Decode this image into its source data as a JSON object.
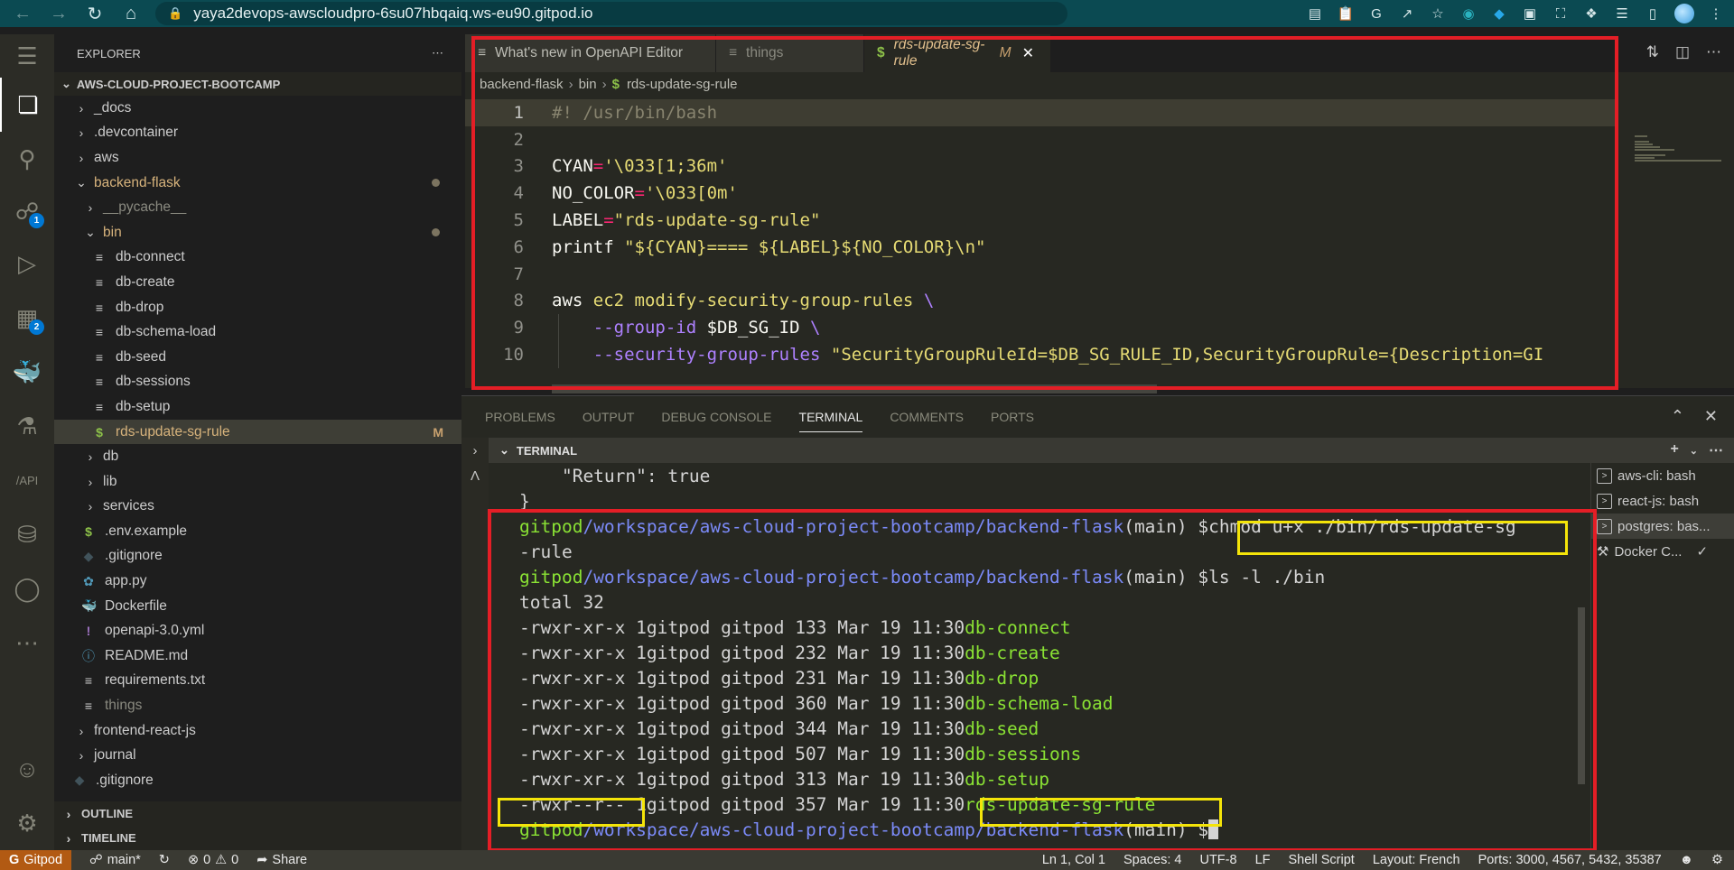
{
  "browser": {
    "url": "yaya2devops-awscloudpro-6su07hbqaiq.ws-eu90.gitpod.io"
  },
  "activity_bar": {
    "items": [
      {
        "name": "explorer",
        "icon": "files-icon"
      },
      {
        "name": "search",
        "icon": "search-icon"
      },
      {
        "name": "source-control",
        "icon": "source-control-icon",
        "badge": "1"
      },
      {
        "name": "run-debug",
        "icon": "run-debug-icon"
      },
      {
        "name": "extensions",
        "icon": "extensions-icon",
        "badge": "2"
      },
      {
        "name": "docker",
        "icon": "docker-icon"
      },
      {
        "name": "testing",
        "icon": "flask-icon"
      },
      {
        "name": "openapi",
        "icon": "api-icon"
      },
      {
        "name": "database",
        "icon": "database-icon"
      },
      {
        "name": "github",
        "icon": "github-icon"
      },
      {
        "name": "more",
        "icon": "ellipsis-icon"
      }
    ],
    "account_icon": "account-icon",
    "settings_icon": "gear-icon"
  },
  "explorer": {
    "title": "EXPLORER",
    "root": "AWS-CLOUD-PROJECT-BOOTCAMP",
    "items": [
      {
        "label": "_docs",
        "type": "folder"
      },
      {
        "label": ".devcontainer",
        "type": "folder"
      },
      {
        "label": "aws",
        "type": "folder"
      },
      {
        "label": "backend-flask",
        "type": "folder-open",
        "modified": true
      },
      {
        "label": "__pycache__",
        "type": "folder"
      },
      {
        "label": "bin",
        "type": "folder-open",
        "modified": true
      },
      {
        "label": "db-connect",
        "type": "file"
      },
      {
        "label": "db-create",
        "type": "file"
      },
      {
        "label": "db-drop",
        "type": "file"
      },
      {
        "label": "db-schema-load",
        "type": "file"
      },
      {
        "label": "db-seed",
        "type": "file"
      },
      {
        "label": "db-sessions",
        "type": "file"
      },
      {
        "label": "db-setup",
        "type": "file"
      },
      {
        "label": "rds-update-sg-rule",
        "type": "shell",
        "flag": "M"
      },
      {
        "label": "db",
        "type": "folder"
      },
      {
        "label": "lib",
        "type": "folder"
      },
      {
        "label": "services",
        "type": "folder"
      },
      {
        "label": ".env.example",
        "type": "shell"
      },
      {
        "label": ".gitignore",
        "type": "git"
      },
      {
        "label": "app.py",
        "type": "python"
      },
      {
        "label": "Dockerfile",
        "type": "docker"
      },
      {
        "label": "openapi-3.0.yml",
        "type": "yaml"
      },
      {
        "label": "README.md",
        "type": "info"
      },
      {
        "label": "requirements.txt",
        "type": "file"
      },
      {
        "label": "things",
        "type": "file"
      },
      {
        "label": "frontend-react-js",
        "type": "folder"
      },
      {
        "label": "journal",
        "type": "folder"
      },
      {
        "label": ".gitignore",
        "type": "git"
      }
    ],
    "outline": "OUTLINE",
    "timeline": "TIMELINE"
  },
  "editor": {
    "tabs": [
      {
        "label": "What's new in OpenAPI Editor",
        "active": false
      },
      {
        "label": "things",
        "active": false
      },
      {
        "label": "rds-update-sg-rule",
        "active": true,
        "flag": "M"
      }
    ],
    "breadcrumb": [
      "backend-flask",
      "bin",
      "rds-update-sg-rule"
    ],
    "lines": [
      {
        "n": "1",
        "text": "#! /usr/bin/bash"
      },
      {
        "n": "2",
        "text": ""
      },
      {
        "n": "3",
        "text": "CYAN='\\033[1;36m'"
      },
      {
        "n": "4",
        "text": "NO_COLOR='\\033[0m'"
      },
      {
        "n": "5",
        "text": "LABEL=\"rds-update-sg-rule\""
      },
      {
        "n": "6",
        "text": "printf \"${CYAN}==== ${LABEL}${NO_COLOR}\\n\""
      },
      {
        "n": "7",
        "text": ""
      },
      {
        "n": "8",
        "text": "aws ec2 modify-security-group-rules \\"
      },
      {
        "n": "9",
        "text": "    --group-id $DB_SG_ID \\"
      },
      {
        "n": "10",
        "text": "    --security-group-rules \"SecurityGroupRuleId=$DB_SG_RULE_ID,SecurityGroupRule={Description=GI"
      }
    ]
  },
  "panel": {
    "tabs": [
      "PROBLEMS",
      "OUTPUT",
      "DEBUG CONSOLE",
      "TERMINAL",
      "COMMENTS",
      "PORTS"
    ],
    "active_tab": "TERMINAL",
    "terminal_header": "TERMINAL",
    "terminal": {
      "prompt_user": "gitpod",
      "prompt_path": "/workspace/aws-cloud-project-bootcamp/backend-flask",
      "prompt_branch": "(main) $",
      "pre_lines": [
        "    \"Return\": true",
        "}"
      ],
      "cmd1": "chmod u+x ./bin/rds-update-sg",
      "cmd1_wrap": "-rule",
      "cmd2": "ls -l ./bin",
      "total": "total 32",
      "listing": [
        {
          "perm": "-rwxr-xr-x 1",
          "rest": "gitpod gitpod 133 Mar 19 11:30",
          "name": "db-connect"
        },
        {
          "perm": "-rwxr-xr-x 1",
          "rest": "gitpod gitpod 232 Mar 19 11:30",
          "name": "db-create"
        },
        {
          "perm": "-rwxr-xr-x 1",
          "rest": "gitpod gitpod 231 Mar 19 11:30",
          "name": "db-drop"
        },
        {
          "perm": "-rwxr-xr-x 1",
          "rest": "gitpod gitpod 360 Mar 19 11:30",
          "name": "db-schema-load"
        },
        {
          "perm": "-rwxr-xr-x 1",
          "rest": "gitpod gitpod 344 Mar 19 11:30",
          "name": "db-seed"
        },
        {
          "perm": "-rwxr-xr-x 1",
          "rest": "gitpod gitpod 507 Mar 19 11:30",
          "name": "db-sessions"
        },
        {
          "perm": "-rwxr-xr-x 1",
          "rest": "gitpod gitpod 313 Mar 19 11:30",
          "name": "db-setup"
        },
        {
          "perm": "-rwxr--r-- 1",
          "rest": "gitpod gitpod 357 Mar 19 11:30",
          "name": "rds-update-sg-rule"
        }
      ]
    },
    "terminal_list": [
      {
        "label": "aws-cli: bash",
        "icon": "terminal-icon"
      },
      {
        "label": "react-js: bash",
        "icon": "terminal-icon"
      },
      {
        "label": "postgres: bas...",
        "icon": "terminal-icon",
        "selected": true
      },
      {
        "label": "Docker C...",
        "icon": "tools-icon",
        "check": true
      }
    ]
  },
  "statusbar": {
    "remote": "Gitpod",
    "branch": "main*",
    "errors": "0",
    "warnings": "0",
    "share": "Share",
    "position": "Ln 1, Col 1",
    "spaces": "Spaces: 4",
    "encoding": "UTF-8",
    "eol": "LF",
    "language": "Shell Script",
    "layout": "Layout: French",
    "ports": "Ports: 3000, 4567, 5432, 35387"
  },
  "colors": {
    "highlight_red": "#e41e26",
    "highlight_yellow": "#f4e409",
    "statusbar_remote": "#b25a13",
    "badge": "#0078d4"
  }
}
